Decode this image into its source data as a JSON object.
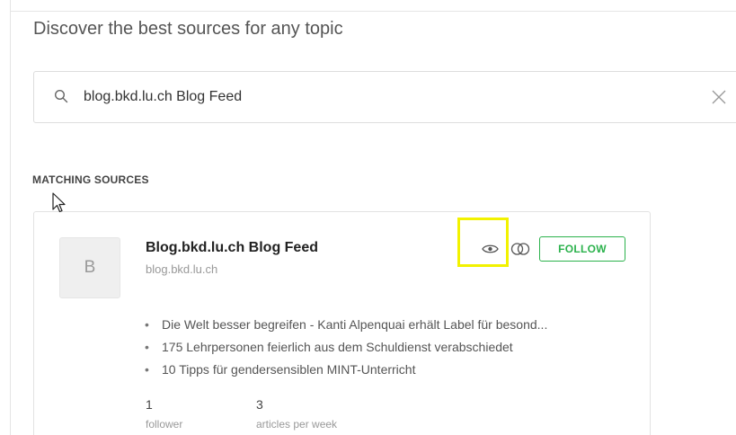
{
  "header": {
    "title": "Discover the best sources for any topic"
  },
  "search": {
    "value": "blog.bkd.lu.ch Blog Feed",
    "icon": "search-icon",
    "clear_icon": "close-icon"
  },
  "results": {
    "heading": "MATCHING SOURCES",
    "sources": [
      {
        "avatar_letter": "B",
        "title": "Blog.bkd.lu.ch Blog Feed",
        "url": "blog.bkd.lu.ch",
        "follow_label": "FOLLOW",
        "articles": [
          "Die Welt besser begreifen - Kanti Alpenquai erhält Label für besond...",
          "175 Lehrpersonen feierlich aus dem Schuldienst verabschiedet",
          "10 Tipps für gendersensiblen MINT-Unterricht"
        ],
        "stats": {
          "followers_value": "1",
          "followers_label": "follower",
          "articles_value": "3",
          "articles_label": "articles per week"
        }
      }
    ]
  },
  "colors": {
    "accent": "#2bb24c",
    "highlight": "#f2f200"
  }
}
